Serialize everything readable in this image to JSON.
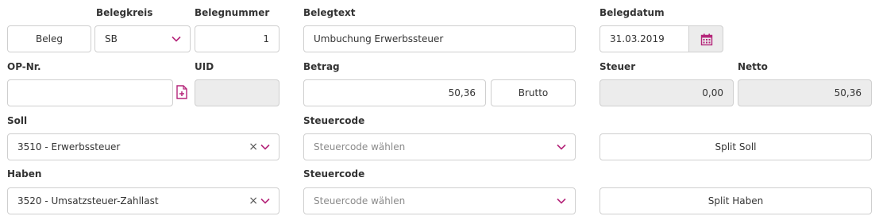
{
  "labels": {
    "belegkreis": "Belegkreis",
    "belegnummer": "Belegnummer",
    "belegtext": "Belegtext",
    "belegdatum": "Belegdatum",
    "op_nr": "OP-Nr.",
    "uid": "UID",
    "betrag": "Betrag",
    "steuer": "Steuer",
    "netto": "Netto",
    "soll": "Soll",
    "steuercode_soll": "Steuercode",
    "haben": "Haben",
    "steuercode_haben": "Steuercode"
  },
  "fields": {
    "beleg_button": "Beleg",
    "belegkreis_value": "SB",
    "belegnummer_value": "1",
    "belegtext_value": "Umbuchung Erwerbssteuer",
    "belegdatum_value": "31.03.2019",
    "op_nr_value": "",
    "uid_value": "",
    "betrag_value": "50,36",
    "brutto_button": "Brutto",
    "steuer_value": "0,00",
    "netto_value": "50,36",
    "soll_value": "3510 - Erwerbssteuer",
    "steuercode_soll_placeholder": "Steuercode wählen",
    "split_soll_button": "Split Soll",
    "haben_value": "3520 - Umsatzsteuer-Zahllast",
    "steuercode_haben_placeholder": "Steuercode wählen",
    "split_haben_button": "Split Haben",
    "clear_symbol": "×"
  },
  "colors": {
    "accent": "#b5267a",
    "border": "#cfcfcf",
    "disabled_bg": "#ececec",
    "text": "#333333",
    "placeholder": "#8a8a8a"
  },
  "icons": {
    "dropdown": "chevron-down-icon",
    "calendar": "calendar-icon",
    "add_document": "add-document-icon",
    "clear": "clear-icon"
  }
}
